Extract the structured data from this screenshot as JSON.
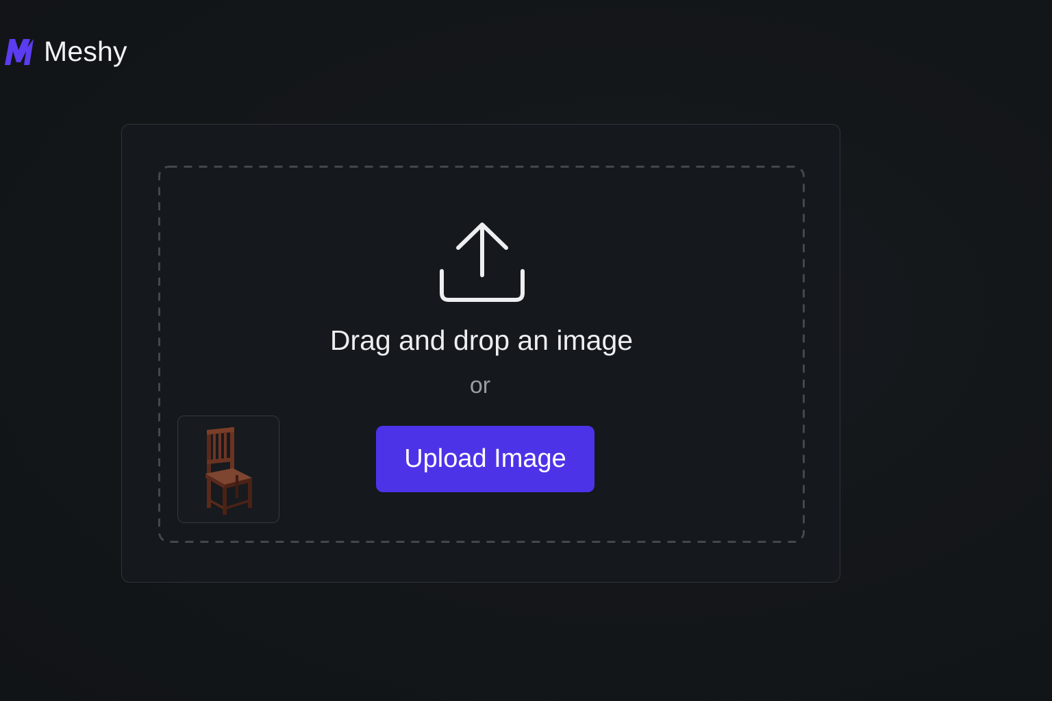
{
  "brand": {
    "name": "Meshy",
    "logo_icon": "meshy-m-logo-icon",
    "logo_color": "#5b3cf0"
  },
  "dropzone": {
    "icon": "upload-icon",
    "title": "Drag and drop an image",
    "separator": "or",
    "upload_button_label": "Upload Image",
    "button_color": "#4d33e8"
  },
  "thumbnail": {
    "icon": "wooden-chair-image"
  }
}
